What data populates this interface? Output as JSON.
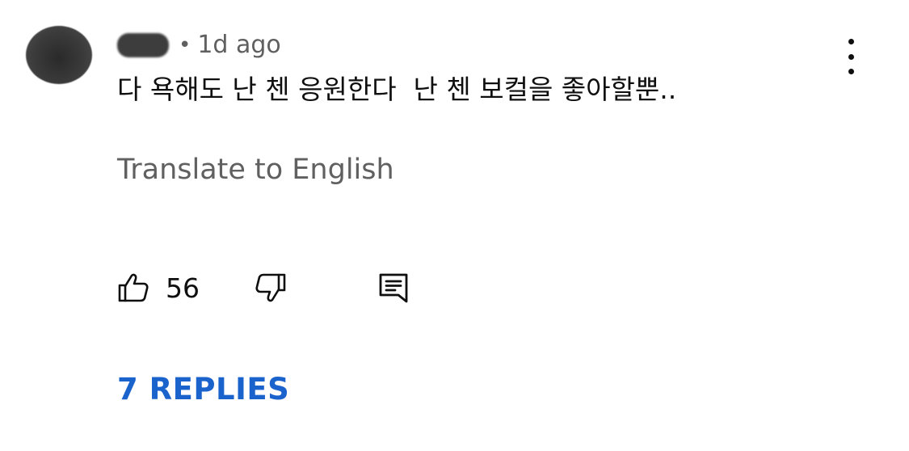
{
  "comment": {
    "timestamp": "1d ago",
    "meta_separator": "•",
    "text": "다 욕해도 난 첸 응원한다  난 첸 보컬을 좋아할뿐..",
    "translate_label": "Translate to English",
    "like_count": "56",
    "replies_label": "7 REPLIES"
  },
  "icons": {
    "more": "more-vertical-icon",
    "like": "thumbs-up-icon",
    "dislike": "thumbs-down-icon",
    "reply": "comment-reply-icon"
  },
  "colors": {
    "text_primary": "#0f0f0f",
    "text_secondary": "#606060",
    "link_blue": "#1a62cc"
  }
}
